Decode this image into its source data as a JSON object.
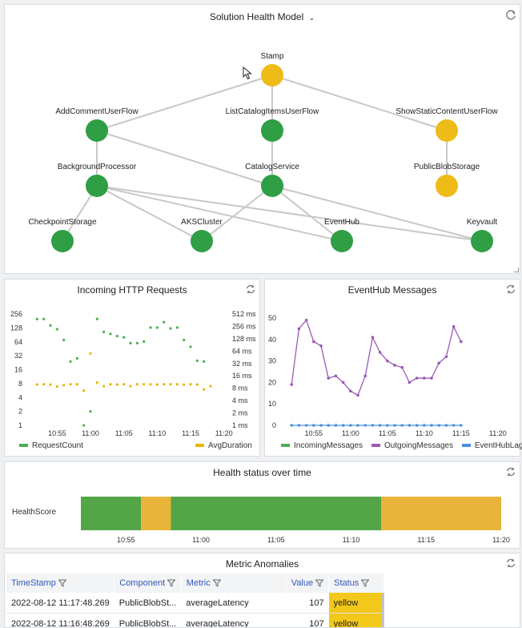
{
  "health_model": {
    "title": "Solution Health Model",
    "colors": {
      "healthy": "#2f9e44",
      "degraded": "#eebb17",
      "edge": "#c8c8c8"
    },
    "nodes": [
      {
        "id": "stamp",
        "label": "Stamp",
        "status": "degraded"
      },
      {
        "id": "addcomment",
        "label": "AddCommentUserFlow",
        "status": "healthy"
      },
      {
        "id": "listcatalog",
        "label": "ListCatalogItemsUserFlow",
        "status": "healthy"
      },
      {
        "id": "showstatic",
        "label": "ShowStaticContentUserFlow",
        "status": "degraded"
      },
      {
        "id": "bgproc",
        "label": "BackgroundProcessor",
        "status": "healthy"
      },
      {
        "id": "catalogsvc",
        "label": "CatalogService",
        "status": "healthy"
      },
      {
        "id": "publicblob",
        "label": "PublicBlobStorage",
        "status": "degraded"
      },
      {
        "id": "checkpoint",
        "label": "CheckpointStorage",
        "status": "healthy"
      },
      {
        "id": "aks",
        "label": "AKSCluster",
        "status": "healthy"
      },
      {
        "id": "eventhub",
        "label": "EventHub",
        "status": "healthy"
      },
      {
        "id": "keyvault",
        "label": "Keyvault",
        "status": "healthy"
      }
    ],
    "edges": [
      [
        "stamp",
        "addcomment"
      ],
      [
        "stamp",
        "listcatalog"
      ],
      [
        "stamp",
        "showstatic"
      ],
      [
        "addcomment",
        "bgproc"
      ],
      [
        "addcomment",
        "catalogsvc"
      ],
      [
        "listcatalog",
        "catalogsvc"
      ],
      [
        "showstatic",
        "publicblob"
      ],
      [
        "bgproc",
        "checkpoint"
      ],
      [
        "bgproc",
        "aks"
      ],
      [
        "bgproc",
        "eventhub"
      ],
      [
        "bgproc",
        "keyvault"
      ],
      [
        "catalogsvc",
        "aks"
      ],
      [
        "catalogsvc",
        "eventhub"
      ],
      [
        "catalogsvc",
        "keyvault"
      ]
    ]
  },
  "http_panel": {
    "title": "Incoming HTTP Requests",
    "legend": [
      {
        "label": "RequestCount",
        "color": "#4caf50"
      },
      {
        "label": "AvgDuration",
        "color": "#e6b800"
      }
    ]
  },
  "eventhub_panel": {
    "title": "EventHub Messages",
    "legend": [
      {
        "label": "IncomingMessages",
        "color": "#4caf50"
      },
      {
        "label": "OutgoingMessages",
        "color": "#9b59b6"
      },
      {
        "label": "EventHubLag",
        "color": "#4a90e2"
      }
    ]
  },
  "health_time_panel": {
    "title": "Health status over time",
    "row_label": "HealthScore"
  },
  "anomalies_panel": {
    "title": "Metric Anomalies",
    "columns": [
      "TimeStamp",
      "Component",
      "Metric",
      "Value",
      "Status"
    ],
    "rows": [
      {
        "timestamp": "2022-08-12 11:17:48.269",
        "component": "PublicBlobSt...",
        "metric": "averageLatency",
        "value": "107",
        "status": "yellow"
      },
      {
        "timestamp": "2022-08-12 11:16:48.269",
        "component": "PublicBlobSt...",
        "metric": "averageLatency",
        "value": "107",
        "status": "yellow"
      }
    ]
  },
  "chart_data": [
    {
      "type": "scatter",
      "title": "Incoming HTTP Requests",
      "x_ticks": [
        "10:55",
        "11:00",
        "11:05",
        "11:10",
        "11:15",
        "11:20"
      ],
      "x_range": [
        "10:51",
        "11:21"
      ],
      "y_left_scale": "log2",
      "y_left_ticks": [
        "1",
        "2",
        "4",
        "8",
        "16",
        "32",
        "64",
        "128",
        "256"
      ],
      "y_right_scale": "log2",
      "y_right_ticks": [
        "1 ms",
        "2 ms",
        "4 ms",
        "8 ms",
        "16 ms",
        "32 ms",
        "64 ms",
        "128 ms",
        "256 ms",
        "512 ms"
      ],
      "series": [
        {
          "name": "RequestCount",
          "color": "#4caf50",
          "axis": "left",
          "x": [
            "10:52",
            "10:53",
            "10:54",
            "10:55",
            "10:56",
            "10:57",
            "10:58",
            "10:59",
            "11:00",
            "11:01",
            "11:02",
            "11:03",
            "11:04",
            "11:05",
            "11:06",
            "11:07",
            "11:08",
            "11:09",
            "11:10",
            "11:11",
            "11:12",
            "11:13",
            "11:14",
            "11:15",
            "11:16",
            "11:17",
            "11:18",
            "11:19"
          ],
          "y": [
            200,
            200,
            145,
            120,
            70,
            24,
            28,
            1,
            2,
            200,
            105,
            95,
            85,
            80,
            60,
            60,
            65,
            130,
            130,
            170,
            125,
            130,
            70,
            50,
            25,
            24,
            null,
            null
          ]
        },
        {
          "name": "AvgDuration",
          "color": "#e6b800",
          "axis": "right",
          "x": [
            "10:52",
            "10:53",
            "10:54",
            "10:55",
            "10:56",
            "10:57",
            "10:58",
            "10:59",
            "11:00",
            "11:01",
            "11:02",
            "11:03",
            "11:04",
            "11:05",
            "11:06",
            "11:07",
            "11:08",
            "11:09",
            "11:10",
            "11:11",
            "11:12",
            "11:13",
            "11:14",
            "11:15",
            "11:16",
            "11:17",
            "11:18"
          ],
          "y": [
            9.8,
            10,
            9.8,
            8.8,
            9.5,
            10,
            10,
            7,
            56,
            11,
            9,
            10,
            9.8,
            10,
            9,
            10,
            10,
            10,
            9.8,
            10,
            10,
            10,
            9.8,
            10,
            9.8,
            7.5,
            9
          ]
        }
      ]
    },
    {
      "type": "line",
      "title": "EventHub Messages",
      "x_ticks": [
        "10:55",
        "11:00",
        "11:05",
        "11:10",
        "11:15",
        "11:20"
      ],
      "x_range": [
        "10:51",
        "11:21"
      ],
      "y_ticks": [
        0,
        10,
        20,
        30,
        40,
        50
      ],
      "ylim": [
        0,
        52
      ],
      "series": [
        {
          "name": "IncomingMessages",
          "color": "#4caf50",
          "x": [],
          "y": []
        },
        {
          "name": "OutgoingMessages",
          "color": "#9b59b6",
          "x": [
            "10:52",
            "10:53",
            "10:54",
            "10:55",
            "10:56",
            "10:57",
            "10:58",
            "10:59",
            "11:00",
            "11:01",
            "11:02",
            "11:03",
            "11:04",
            "11:05",
            "11:06",
            "11:07",
            "11:08",
            "11:09",
            "11:10",
            "11:11",
            "11:12",
            "11:13",
            "11:14",
            "11:15"
          ],
          "y": [
            19,
            45,
            49,
            39,
            37,
            22,
            23,
            20,
            16,
            14,
            23,
            41,
            34,
            30,
            28,
            27,
            20,
            22,
            22,
            22,
            29,
            32,
            46,
            39
          ]
        },
        {
          "name": "EventHubLag",
          "color": "#4a90e2",
          "x": [
            "10:52",
            "10:53",
            "10:54",
            "10:55",
            "10:56",
            "10:57",
            "10:58",
            "10:59",
            "11:00",
            "11:01",
            "11:02",
            "11:03",
            "11:04",
            "11:05",
            "11:06",
            "11:07",
            "11:08",
            "11:09",
            "11:10",
            "11:11",
            "11:12",
            "11:13",
            "11:14",
            "11:15"
          ],
          "y": [
            0,
            0,
            0,
            0,
            0,
            0,
            0,
            0,
            0,
            0,
            0,
            0,
            0,
            0,
            0,
            0,
            0,
            0,
            0,
            0,
            0,
            0,
            0,
            0
          ]
        }
      ]
    },
    {
      "type": "bar",
      "title": "Health status over time",
      "x_ticks": [
        "10:55",
        "11:00",
        "11:05",
        "11:10",
        "11:15",
        "11:20"
      ],
      "x_range": [
        "10:52",
        "11:20"
      ],
      "segments": [
        {
          "start": "10:52",
          "end": "10:56",
          "status": "healthy",
          "color": "#53a548"
        },
        {
          "start": "10:56",
          "end": "10:58",
          "status": "degraded",
          "color": "#e8b53a"
        },
        {
          "start": "10:58",
          "end": "11:12",
          "status": "healthy",
          "color": "#53a548"
        },
        {
          "start": "11:12",
          "end": "11:20",
          "status": "degraded",
          "color": "#e8b53a"
        }
      ]
    }
  ]
}
